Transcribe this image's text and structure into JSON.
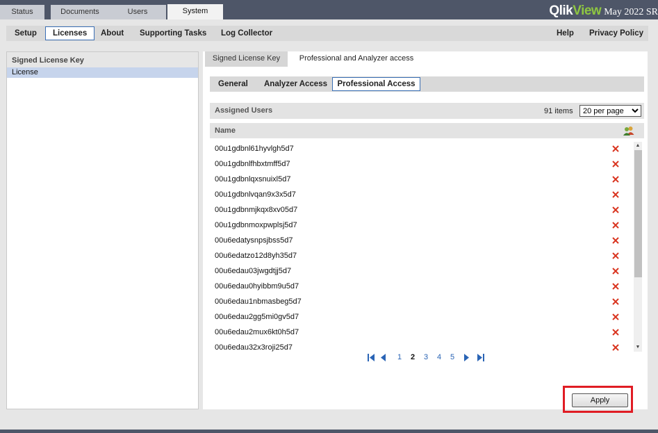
{
  "top_tabs": [
    "Status",
    "Documents",
    "Users",
    "System"
  ],
  "brand": {
    "logo_qlik": "Qlik",
    "logo_view": "View",
    "version": "May 2022 SR"
  },
  "subnav": {
    "left": [
      "Setup",
      "Licenses",
      "About",
      "Supporting Tasks",
      "Log Collector"
    ],
    "right": [
      "Help",
      "Privacy Policy"
    ]
  },
  "left_panel": {
    "header": "Signed License Key",
    "item": "License"
  },
  "right_tabs": [
    "Signed License Key",
    "Professional and Analyzer access"
  ],
  "inner_tabs": [
    "General",
    "Analyzer Access",
    "Professional Access"
  ],
  "assigned": {
    "title": "Assigned Users",
    "count": "91 items",
    "per_page": "20 per page"
  },
  "list_header": "Name",
  "users": [
    "00u1gdbnl61hyvlgh5d7",
    "00u1gdbnlfhbxtmff5d7",
    "00u1gdbnlqxsnuixl5d7",
    "00u1gdbnlvqan9x3x5d7",
    "00u1gdbnmjkqx8xv05d7",
    "00u1gdbnmoxpwplsj5d7",
    "00u6edatysnpsjbss5d7",
    "00u6edatzo12d8yh35d7",
    "00u6edau03jwgdtjj5d7",
    "00u6edau0hyibbm9u5d7",
    "00u6edau1nbmasbeg5d7",
    "00u6edau2gg5mi0gv5d7",
    "00u6edau2mux6kt0h5d7",
    "00u6edau32x3roji25d7"
  ],
  "pager": {
    "pages": [
      "1",
      "2",
      "3",
      "4",
      "5"
    ],
    "current": "2"
  },
  "apply_label": "Apply",
  "colors": {
    "topbar": "#4e5668",
    "accent_border": "#3a6fb5",
    "highlight_box": "#e01c24",
    "logo_green": "#8ec641",
    "link_blue": "#2a64b5",
    "delete_red": "#d9341f"
  }
}
